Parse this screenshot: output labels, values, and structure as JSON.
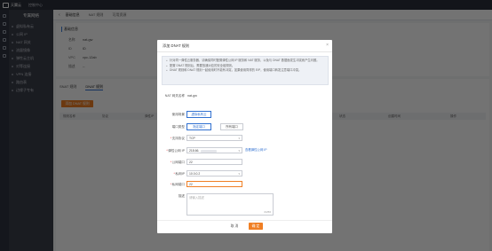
{
  "topbar": {
    "brand": "天翼云",
    "console": "控制中心"
  },
  "sidebar": {
    "title": "专属网络",
    "items": [
      "虚拟私有云",
      "公网 IP",
      "NAT 网关",
      "流量镜像",
      "弹性云主机",
      "对等连接",
      "VPN 连接",
      "路由表",
      "边缘子专有"
    ]
  },
  "main": {
    "back": "‹",
    "tabs": [
      "基础信息",
      "NAT 规则",
      "可用资源"
    ],
    "section_title": "基础信息",
    "kv": [
      {
        "k": "名称",
        "v": "nat-gw"
      },
      {
        "k": "ID",
        "v": "ID"
      },
      {
        "k": "VPC",
        "v": "vpc-12ab"
      },
      {
        "k": "描述",
        "v": "--"
      }
    ],
    "subtabs": [
      "SNAT 规则",
      "DNAT 规则"
    ],
    "add_button": "添加 DNAT 规则",
    "table_headers": [
      "规则名称",
      "协议",
      "弹性IP",
      "外部端口",
      "内部IP",
      "内部端口",
      "状态",
      "创建时间",
      "操作"
    ]
  },
  "dialog": {
    "title": "添加 DNAT 规则",
    "close": "×",
    "notices": [
      "针对同一弹性云服务器，请确保同时配置弹性公网 IP 服务和 NAT 服务，以免与 DNAT 数据面发生冲突而产生问题。",
      "配置 DNAT 规则后，需要放通对应的安全组规则。",
      "DNAT 规则和 DNAT 规则一起使用时不能有冲突，如果使用同样的 EIP，使用端口转发注意端口冲突。"
    ],
    "gateway_label": "NAT 网关名称",
    "gateway_value": "nat-gw",
    "scene_label": "使用场景",
    "scene_option": "虚拟私有云",
    "port_type_label": "端口类型",
    "port_type_options": [
      "指定端口",
      "所有端口"
    ],
    "protocol_label": "支持协议",
    "protocol_value": "TCP",
    "eip_label": "弹性公网 IP",
    "eip_value": "218.66.",
    "eip_link": "查看弹性公网 IP",
    "public_port_label": "公网端口",
    "public_port_value": "22",
    "private_ip_label": "私网IP",
    "private_ip_value": "10.0.0.2",
    "private_port_label": "私网端口",
    "private_port_value": "22",
    "desc_label": "描述",
    "desc_placeholder": "请输入描述",
    "desc_counter": "0/256",
    "cancel": "取 消",
    "ok": "确 定"
  },
  "colors": {
    "accent": "#f07f24",
    "link": "#2f6fd0",
    "topbar": "#2b2f3a",
    "sidebar": "#3a3e4b"
  }
}
